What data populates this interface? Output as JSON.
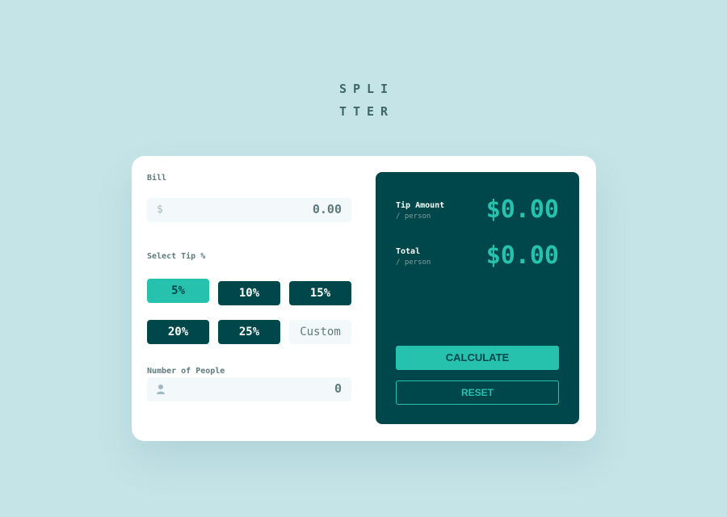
{
  "logo": {
    "line1": "SPLI",
    "line2": "TTER"
  },
  "bill": {
    "label": "Bill",
    "prefix": "$",
    "value": "0.00"
  },
  "tip": {
    "label": "Select Tip %",
    "options": [
      "5%",
      "10%",
      "15%",
      "20%",
      "25%"
    ],
    "custom_placeholder": "Custom",
    "selected": "5%"
  },
  "people": {
    "label": "Number of People",
    "value": "0"
  },
  "results": {
    "tip_amount_label": "Tip Amount",
    "tip_amount_sub": "/ person",
    "tip_amount_value": "$0.00",
    "total_label": "Total",
    "total_sub": "/ person",
    "total_value": "$0.00"
  },
  "buttons": {
    "calculate": "CALCULATE",
    "reset": "RESET"
  },
  "colors": {
    "background": "#c5e4e7",
    "dark_cyan": "#00474b",
    "strong_cyan": "#26c2ae",
    "grayish_cyan": "#5e7a7d",
    "input_bg": "#f3f9fa"
  }
}
